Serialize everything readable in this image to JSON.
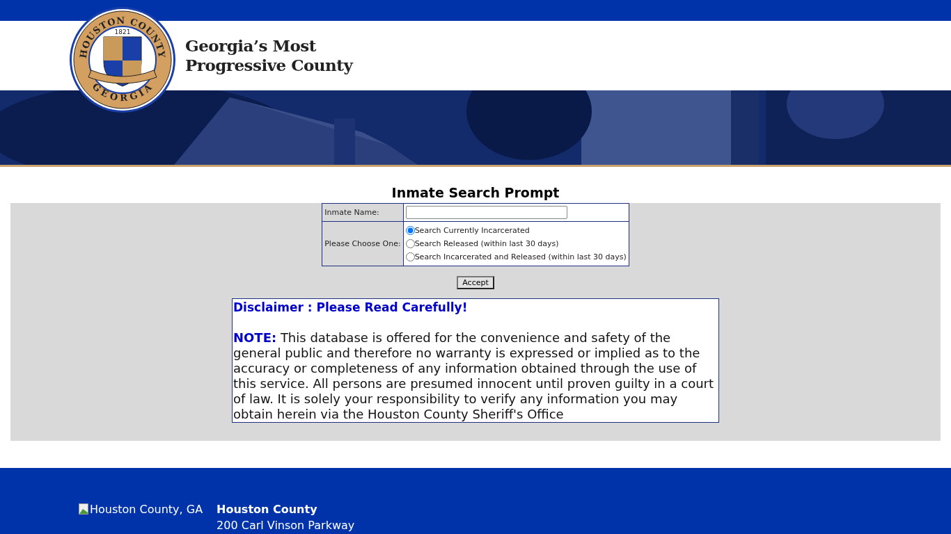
{
  "header": {
    "seal": {
      "top": "HOUSTON COUNTY",
      "year": "1821",
      "bottom": "GEORGIA"
    },
    "tagline": [
      "Georgia’s Most",
      "Progressive County"
    ]
  },
  "search": {
    "title": "Inmate Search Prompt",
    "name_label": "Inmate Name:",
    "choose_label": "Please Choose One:",
    "options": [
      {
        "label": "Search Currently Incarcerated",
        "selected": true
      },
      {
        "label": "Search Released (within last 30 days)",
        "selected": false
      },
      {
        "label": "Search Incarcerated and Released (within last 30 days)",
        "selected": false
      }
    ],
    "button": "Accept"
  },
  "disclaimer": {
    "title": "Disclaimer : Please Read Carefully!",
    "note_label": "NOTE:",
    "text": "This database is offered for the convenience and safety of the general public and therefore no warranty is expressed or implied as to the accuracy or completeness of any information obtained through the use of this service. All persons are presumed innocent until proven guilty in a court of law. It is solely your responsibility to verify any information you may obtain herein via the Houston County Sheriff's Office"
  },
  "footer": {
    "logo_alt": "Houston County, GA",
    "name": "Houston County",
    "address": "200 Carl Vinson Parkway"
  }
}
